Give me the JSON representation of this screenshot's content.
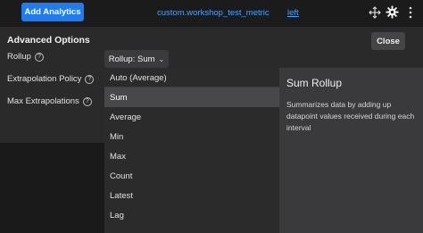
{
  "topbar": {
    "add_analytics_label": "Add Analytics",
    "metric_name": "custom.workshop_test_metric",
    "axis_link": "left"
  },
  "options": {
    "title": "Advanced Options",
    "close_label": "Close",
    "rollup_label": "Rollup",
    "extrapolation_policy_label": "Extrapolation Policy",
    "max_extrapolations_label": "Max Extrapolations",
    "help_glyph": "?",
    "rollup_select_value": "Rollup: Sum",
    "chevron": "⌄"
  },
  "dropdown": {
    "items": [
      {
        "label": "Auto (Average)"
      },
      {
        "label": "Sum"
      },
      {
        "label": "Average"
      },
      {
        "label": "Min"
      },
      {
        "label": "Max"
      },
      {
        "label": "Count"
      },
      {
        "label": "Latest"
      },
      {
        "label": "Lag"
      }
    ],
    "selected_index": 1
  },
  "description": {
    "title": "Sum Rollup",
    "text": "Summarizes data by adding up datapoint values received during each interval"
  },
  "colors": {
    "accent": "#1f7bf2",
    "link": "#4aa3ff"
  },
  "icons": {
    "move": "move-icon",
    "settings": "gear-icon",
    "more": "more-icon",
    "help": "help-icon"
  }
}
